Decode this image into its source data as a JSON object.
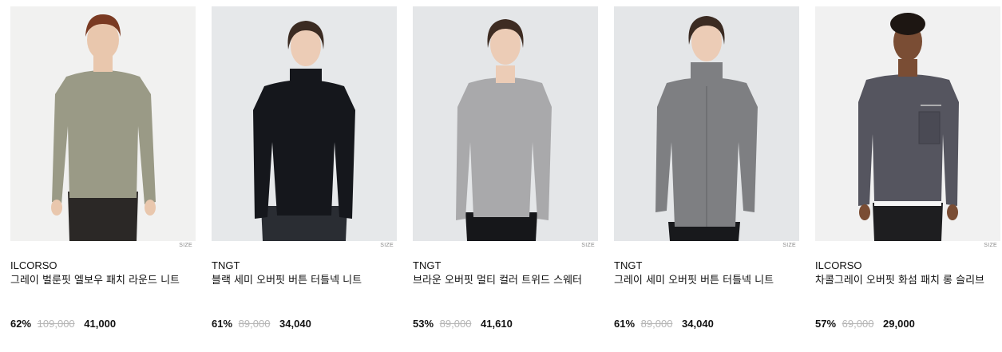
{
  "products": [
    {
      "brand": "ILCORSO",
      "name": "그레이 벌룬핏 엘보우 패치 라운드 니트",
      "discount": "62%",
      "original_price": "109,000",
      "sale_price": "41,000",
      "size_label": "SIZE",
      "colors": {
        "bg": "#f1f1f0",
        "garment": "#9a9a86",
        "hair": "#7a3a22",
        "pants": "#2b2826",
        "skin": "#e9c7ad"
      }
    },
    {
      "brand": "TNGT",
      "name": "블랙 세미 오버핏 버튼 터틀넥 니트",
      "discount": "61%",
      "original_price": "89,000",
      "sale_price": "34,040",
      "size_label": "SIZE",
      "colors": {
        "bg": "#e6e8ea",
        "garment": "#15171c",
        "hair": "#3b2b22",
        "pants": "#2a2d33",
        "skin": "#ecccb6"
      }
    },
    {
      "brand": "TNGT",
      "name": "브라운 오버핏 멀티 컬러 트위드 스웨터",
      "discount": "53%",
      "original_price": "89,000",
      "sale_price": "41,610",
      "size_label": "SIZE",
      "colors": {
        "bg": "#e4e6e8",
        "garment": "#a9a9ab",
        "hair": "#3e2c22",
        "pants": "#16171a",
        "skin": "#ecccb6"
      }
    },
    {
      "brand": "TNGT",
      "name": "그레이 세미 오버핏 버튼 터틀넥 니트",
      "discount": "61%",
      "original_price": "89,000",
      "sale_price": "34,040",
      "size_label": "SIZE",
      "colors": {
        "bg": "#e4e6e8",
        "garment": "#7e7f82",
        "hair": "#3b2b22",
        "pants": "#18191c",
        "skin": "#ecccb6"
      }
    },
    {
      "brand": "ILCORSO",
      "name": "차콜그레이 오버핏 화섬 패치 롱 슬리브",
      "discount": "57%",
      "original_price": "69,000",
      "sale_price": "29,000",
      "size_label": "SIZE",
      "colors": {
        "bg": "#f1f1f1",
        "garment": "#55555f",
        "hair": "#1d1612",
        "pants": "#1e1e20",
        "skin": "#7a4d34"
      }
    }
  ]
}
